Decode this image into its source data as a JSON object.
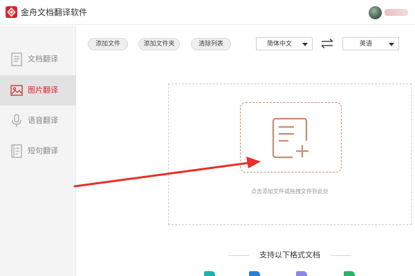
{
  "window": {
    "title": "金舟文档翻译软件"
  },
  "sidebar": {
    "items": [
      {
        "label": "文档翻译",
        "icon": "document-icon",
        "active": false
      },
      {
        "label": "图片翻译",
        "icon": "image-icon",
        "active": true
      },
      {
        "label": "语音翻译",
        "icon": "microphone-icon",
        "active": false
      },
      {
        "label": "短句翻译",
        "icon": "text-icon",
        "active": false
      }
    ]
  },
  "toolbar": {
    "add_file_label": "添加文件",
    "add_folder_label": "添加文件夹",
    "clear_list_label": "清除列表",
    "source_language": "简体中文",
    "target_language": "英语",
    "swap_icon": "swap-arrows-icon"
  },
  "dropzone": {
    "hint": "点击添加文件或拖拽文件到此处",
    "icon": "add-file-icon"
  },
  "formats": {
    "title": "支持以下格式文档"
  },
  "colors": {
    "brand": "#d8262e",
    "dropzone_accent": "#c98b72",
    "annotation_arrow": "#e8302a"
  }
}
